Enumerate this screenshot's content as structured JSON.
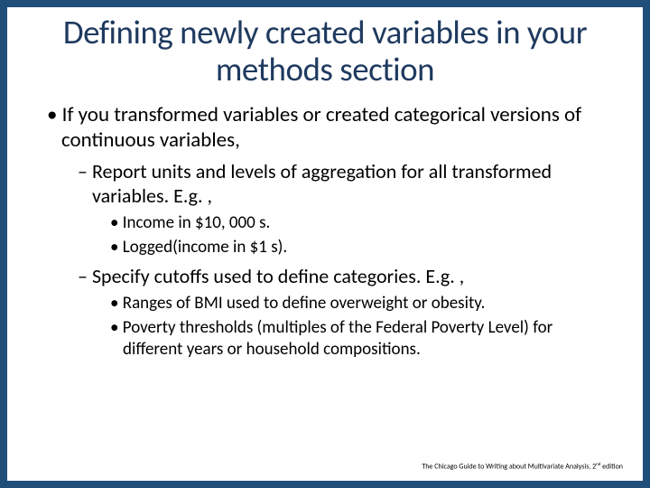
{
  "slide": {
    "title": "Defining newly created variables in your methods section",
    "bullets": {
      "l1a": "If you transformed variables or created categorical versions of continuous variables,",
      "l2a": "Report units and levels of aggregation for all transformed variables. E.g. ,",
      "l3a": "Income in $10, 000 s.",
      "l3b": "Logged(income in $1 s).",
      "l2b": "Specify cutoffs used to define categories. E.g. ,",
      "l3c": "Ranges of BMI used to define overweight or obesity.",
      "l3d": "Poverty thresholds (multiples of the Federal Poverty Level) for different years or household compositions."
    },
    "footer_prefix": "The Chicago Guide to Writing about Multivariate Analysis, 2",
    "footer_suffix": " edition",
    "footer_sup": "nd"
  }
}
